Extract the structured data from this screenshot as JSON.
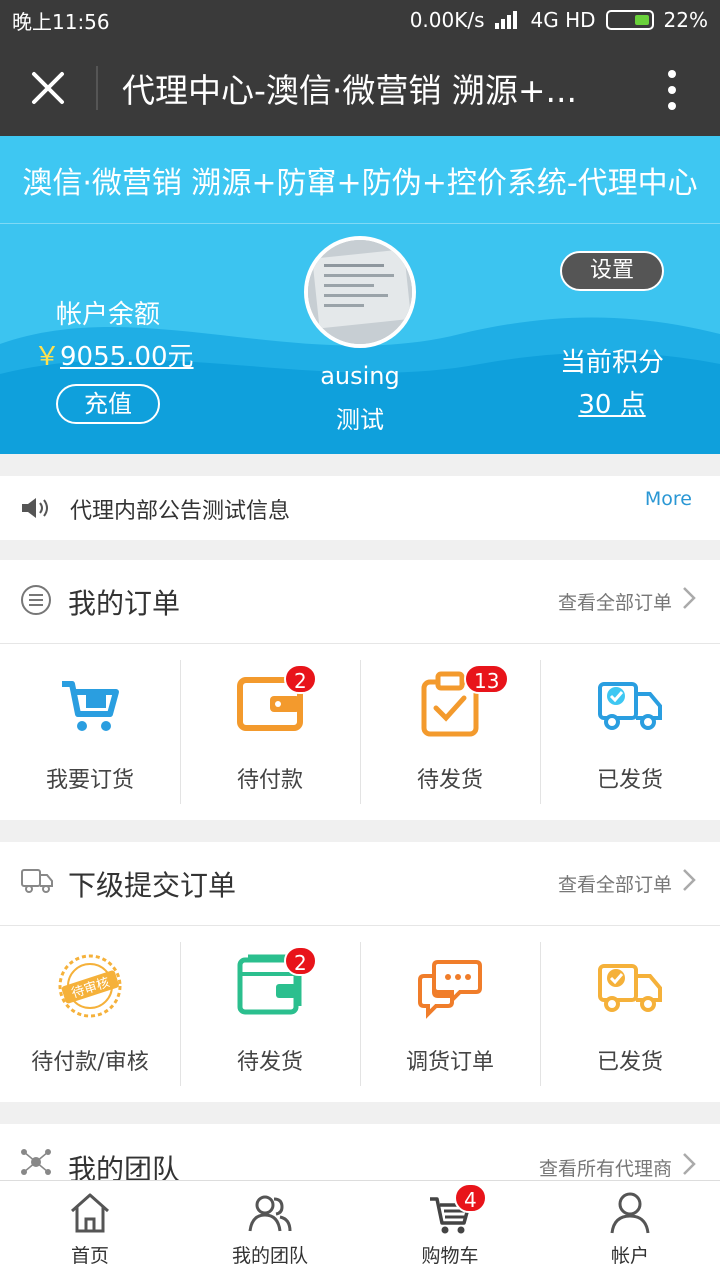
{
  "status_bar": {
    "time": "晚上11:56",
    "net_speed": "0.00K/s",
    "network": "4G HD",
    "battery": "22%"
  },
  "title_bar": {
    "title": "代理中心-澳信·微营销 溯源+..."
  },
  "system_banner": "澳信·微营销 溯源+防窜+防伪+控价系统-代理中心",
  "profile": {
    "balance_label": "帐户余额",
    "currency": "￥",
    "balance": "9055.00元",
    "recharge_label": "充值",
    "username": "ausing",
    "level": "测试",
    "settings_label": "设置",
    "points_label": "当前积分",
    "points": "30 点"
  },
  "notice": {
    "text": "代理内部公告测试信息",
    "more": "More"
  },
  "my_orders": {
    "title": "我的订单",
    "link": "查看全部订单",
    "items": [
      {
        "label": "我要订货",
        "icon": "cart-icon",
        "badge": ""
      },
      {
        "label": "待付款",
        "icon": "wallet-icon",
        "badge": "2"
      },
      {
        "label": "待发货",
        "icon": "clipboard-check-icon",
        "badge": "13"
      },
      {
        "label": "已发货",
        "icon": "truck-icon",
        "badge": ""
      }
    ]
  },
  "sub_orders": {
    "title": "下级提交订单",
    "link": "查看全部订单",
    "items": [
      {
        "label": "待付款/审核",
        "icon": "pending-review-stamp-icon",
        "badge": "",
        "stamp_text": "待审核"
      },
      {
        "label": "待发货",
        "icon": "wallet-icon",
        "badge": "2"
      },
      {
        "label": "调货订单",
        "icon": "chat-icon",
        "badge": ""
      },
      {
        "label": "已发货",
        "icon": "truck-icon",
        "badge": ""
      }
    ]
  },
  "team": {
    "title": "我的团队",
    "link": "查看所有代理商"
  },
  "bottom_nav": {
    "items": [
      {
        "label": "首页",
        "icon": "home-icon"
      },
      {
        "label": "我的团队",
        "icon": "team-icon"
      },
      {
        "label": "购物车",
        "icon": "cart-icon",
        "badge": "4"
      },
      {
        "label": "帐户",
        "icon": "user-icon"
      }
    ]
  },
  "colors": {
    "brand_blue": "#3ec7f2",
    "badge_red": "#e8141a",
    "orange": "#f39a2d",
    "green": "#2bbf8e",
    "link_blue": "#2a97d4"
  }
}
